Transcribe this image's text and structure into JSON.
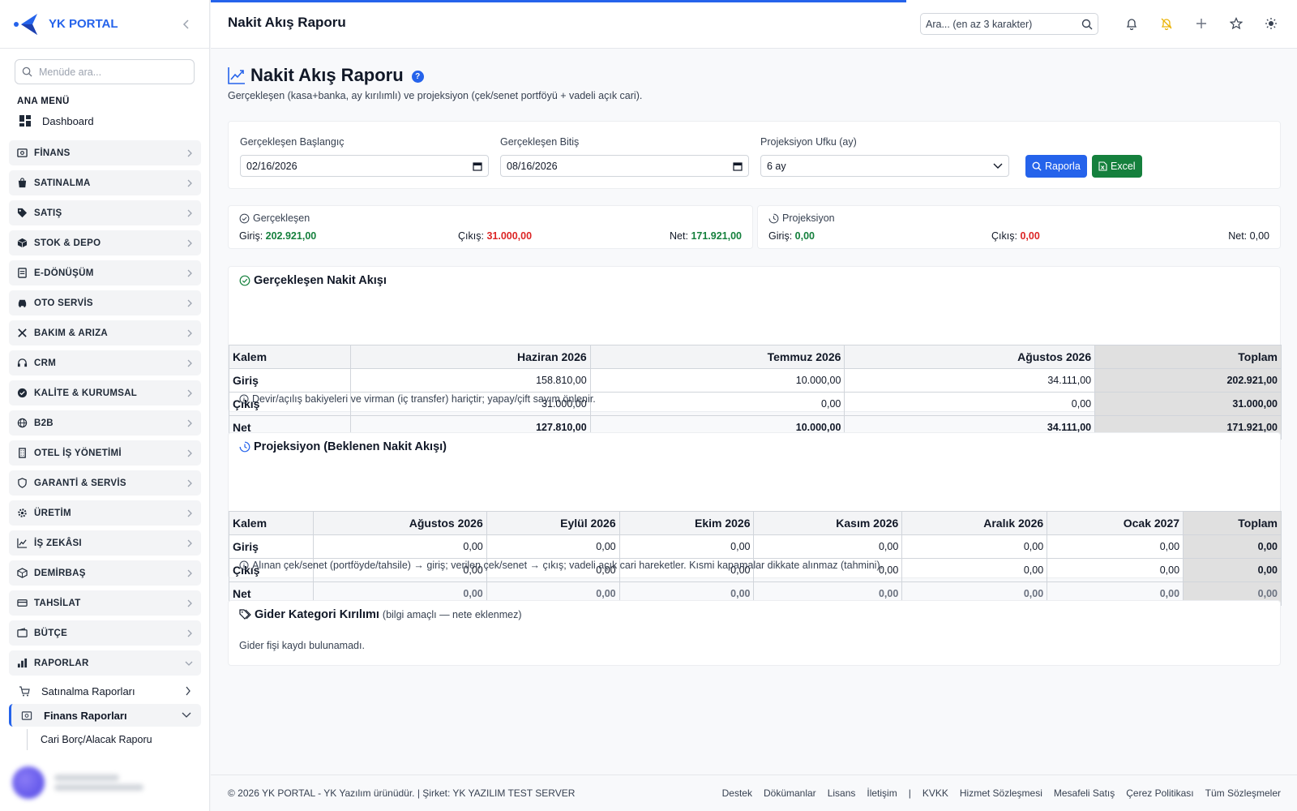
{
  "brand": {
    "name": "YK PORTAL"
  },
  "sidebar": {
    "search_placeholder": "Menüde ara...",
    "heading": "ANA MENÜ",
    "dashboard": "Dashboard",
    "groups": [
      "FİNANS",
      "SATINALMA",
      "SATIŞ",
      "STOK & DEPO",
      "E-DÖNÜŞÜM",
      "OTO SERVİS",
      "BAKIM & ARIZA",
      "CRM",
      "KALİTE & KURUMSAL",
      "B2B",
      "OTEL İŞ YÖNETİMİ",
      "GARANTİ & SERVİS",
      "ÜRETİM",
      "İŞ ZEKÂSI",
      "DEMİRBAŞ",
      "TAHSİLAT",
      "BÜTÇE",
      "RAPORLAR"
    ],
    "sub_items": [
      "Satınalma Raporları",
      "Finans Raporları"
    ],
    "subsub_items": [
      "Cari Borç/Alacak Raporu"
    ]
  },
  "topbar": {
    "title": "Nakit Akış Raporu",
    "search_placeholder": "Ara... (en az 3 karakter)",
    "progress": 0.64
  },
  "page": {
    "title": "Nakit Akış Raporu",
    "help": "?",
    "description": "Gerçekleşen (kasa+banka, ay kırılımlı) ve projeksiyon (çek/senet portföyü + vadeli açık cari)."
  },
  "filters": {
    "start_label": "Gerçekleşen Başlangıç",
    "start_value": "02/16/2026",
    "end_label": "Gerçekleşen Bitiş",
    "end_value": "08/16/2026",
    "horizon_label": "Projeksiyon Ufku (ay)",
    "horizon_value": "6 ay",
    "report_button": "Raporla",
    "excel_button": "Excel"
  },
  "summary": {
    "realized": {
      "title": "Gerçekleşen",
      "in_label": "Giriş:",
      "in_value": "202.921,00",
      "out_label": "Çıkış:",
      "out_value": "31.000,00",
      "net_label": "Net:",
      "net_value": "171.921,00"
    },
    "projection": {
      "title": "Projeksiyon",
      "in_label": "Giriş:",
      "in_value": "0,00",
      "out_label": "Çıkış:",
      "out_value": "0,00",
      "net_label": "Net:",
      "net_value": "0,00"
    }
  },
  "realized_table": {
    "title": "Gerçekleşen Nakit Akışı",
    "headers": [
      "Kalem",
      "Haziran 2026",
      "Temmuz 2026",
      "Ağustos 2026",
      "Toplam"
    ],
    "rows": [
      {
        "label": "Giriş",
        "values": [
          "158.810,00",
          "10.000,00",
          "34.111,00",
          "202.921,00"
        ]
      },
      {
        "label": "Çıkış",
        "values": [
          "31.000,00",
          "0,00",
          "0,00",
          "31.000,00"
        ]
      },
      {
        "label": "Net",
        "values": [
          "127.810,00",
          "10.000,00",
          "34.111,00",
          "171.921,00"
        ]
      }
    ],
    "note": "Devir/açılış bakiyeleri ve virman (iç transfer) hariçtir; yapay/çift sayım önlenir."
  },
  "projection_table": {
    "title": "Projeksiyon (Beklenen Nakit Akışı)",
    "headers": [
      "Kalem",
      "Ağustos 2026",
      "Eylül 2026",
      "Ekim 2026",
      "Kasım 2026",
      "Aralık 2026",
      "Ocak 2027",
      "Toplam"
    ],
    "rows": [
      {
        "label": "Giriş",
        "values": [
          "0,00",
          "0,00",
          "0,00",
          "0,00",
          "0,00",
          "0,00",
          "0,00"
        ]
      },
      {
        "label": "Çıkış",
        "values": [
          "0,00",
          "0,00",
          "0,00",
          "0,00",
          "0,00",
          "0,00",
          "0,00"
        ]
      },
      {
        "label": "Net",
        "values": [
          "0,00",
          "0,00",
          "0,00",
          "0,00",
          "0,00",
          "0,00",
          "0,00"
        ]
      }
    ],
    "note": "Alınan çek/senet (portföyde/tahsile) → giriş; verilen çek/senet → çıkış; vadeli açık cari hareketler. Kısmi kapamalar dikkate alınmaz (tahmini)."
  },
  "expense": {
    "title": "Gider Kategori Kırılımı",
    "note": "(bilgi amaçlı — nete eklenmez)",
    "empty": "Gider fişi kaydı bulunamadı."
  },
  "footer": {
    "copyright": "© 2026 YK PORTAL - YK Yazılım ürünüdür. | Şirket: YK YAZILIM TEST SERVER",
    "links_left": [
      "Destek",
      "Dökümanlar",
      "Lisans",
      "İletişim"
    ],
    "separator": "|",
    "links_right": [
      "KVKK",
      "Hizmet Sözleşmesi",
      "Mesafeli Satış",
      "Çerez Politikası",
      "Tüm Sözleşmeler"
    ]
  },
  "colors": {
    "accent": "#2563eb",
    "positive": "#15803d",
    "negative": "#dc2626",
    "excel": "#15803d"
  }
}
